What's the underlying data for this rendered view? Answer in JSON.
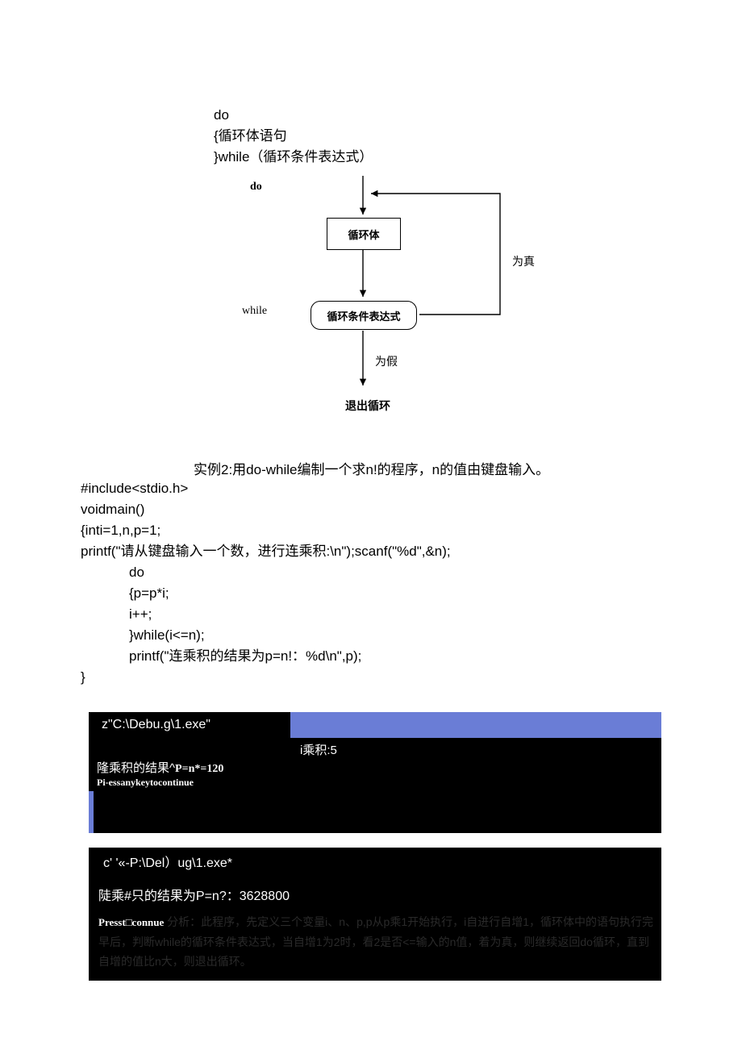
{
  "syntax": {
    "l1": "do",
    "l2": "{循环体语句",
    "l3": "}while（循环条件表达式）"
  },
  "diagram": {
    "do": "do",
    "while": "while",
    "body": "循环体",
    "cond": "循环条件表达式",
    "true": "为真",
    "false": "为假",
    "exit": "退出循环"
  },
  "example": "实例2:用do-while编制一个求n!的程序，n的值由键盘输入。",
  "code": {
    "l1": "#include<stdio.h>",
    "l2": "voidmain()",
    "l3": "{inti=1,n,p=1;",
    "l4": "printf(\"请从键盘输入一个数，进行连乘积:\\n\");scanf(\"%d\",&n);",
    "l5": "do",
    "l6": "{p=p*i;",
    "l7": "i++;",
    "l8": "}while(i<=n);",
    "l9": "printf(\"连乘积的结果为p=n!：%d\\n\",p);",
    "l10": "}"
  },
  "c1": {
    "title": "z\"C:\\Debu.g\\1.exe\"",
    "sub": "i乘积:5",
    "line1a": "隆乘积的结果^",
    "line1b": "P=n*=120",
    "line2": "Pi-essanykeytocontinue"
  },
  "c2": {
    "title": "c'  '«-P:\\Del）ug\\1.exe*",
    "line": "陡乘#只的结果为P=n?：3628800",
    "press": "Presst□connue",
    "analysis": "分析：此程序，先定义三个变量i、n、p,p从p乘1开始执行，i自进行自增1，循环体中的语句执行完早后，判断while的循环条件表达式，当自增1为2时，看2是否<=输入的n值，着为真，则继续返回do循环，直到自增的值比n大，则退出循环。"
  }
}
